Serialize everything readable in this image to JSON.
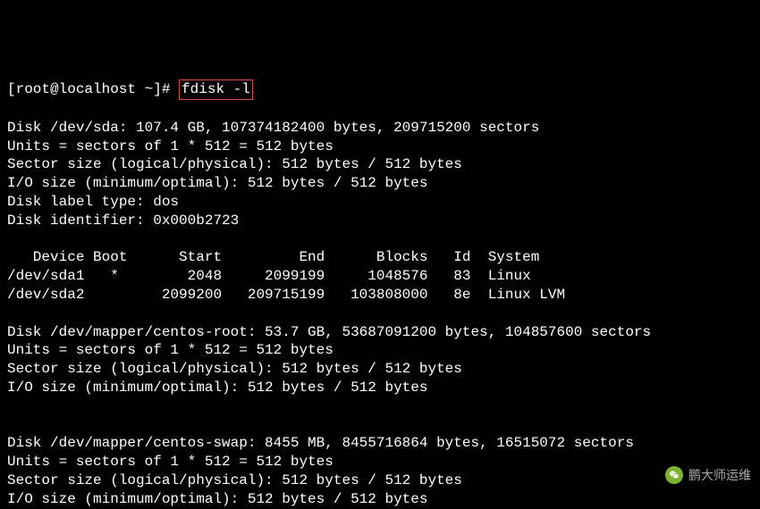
{
  "prompt": "[root@localhost ~]# ",
  "command": "fdisk -l",
  "disks": [
    {
      "header": "Disk /dev/sda: 107.4 GB, 107374182400 bytes, 209715200 sectors",
      "units": "Units = sectors of 1 * 512 = 512 bytes",
      "sector": "Sector size (logical/physical): 512 bytes / 512 bytes",
      "io": "I/O size (minimum/optimal): 512 bytes / 512 bytes",
      "label": "Disk label type: dos",
      "ident": "Disk identifier: 0x000b2723"
    },
    {
      "header": "Disk /dev/mapper/centos-root: 53.7 GB, 53687091200 bytes, 104857600 sectors",
      "units": "Units = sectors of 1 * 512 = 512 bytes",
      "sector": "Sector size (logical/physical): 512 bytes / 512 bytes",
      "io": "I/O size (minimum/optimal): 512 bytes / 512 bytes"
    },
    {
      "header": "Disk /dev/mapper/centos-swap: 8455 MB, 8455716864 bytes, 16515072 sectors",
      "units": "Units = sectors of 1 * 512 = 512 bytes",
      "sector": "Sector size (logical/physical): 512 bytes / 512 bytes",
      "io": "I/O size (minimum/optimal): 512 bytes / 512 bytes"
    }
  ],
  "partition_table": {
    "header": "   Device Boot      Start         End      Blocks   Id  System",
    "rows": [
      "/dev/sda1   *        2048     2099199     1048576   83  Linux",
      "/dev/sda2         2099200   209715199   103808000   8e  Linux LVM"
    ]
  },
  "watermark_text": "鹏大师运维"
}
